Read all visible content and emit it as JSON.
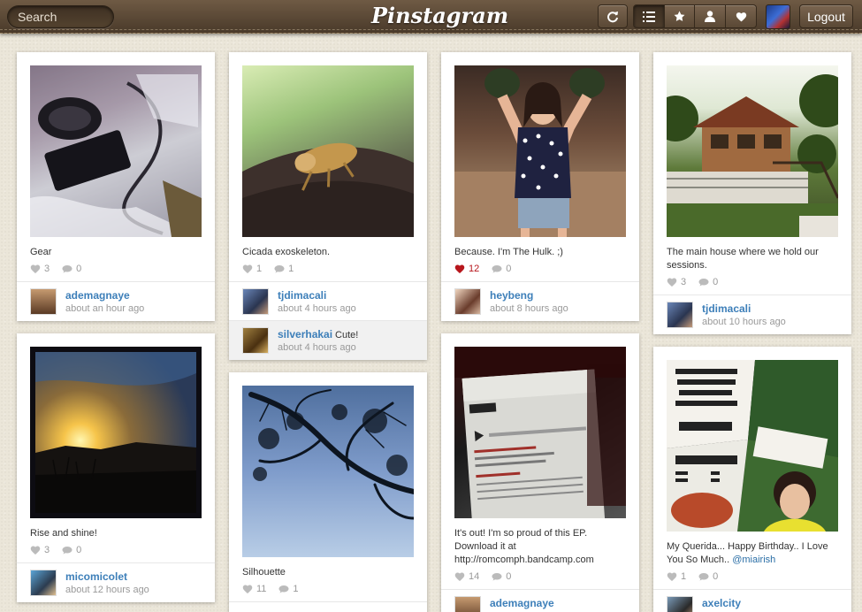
{
  "app": {
    "logo": "Pinstagram"
  },
  "search": {
    "placeholder": "Search"
  },
  "toolbar": {
    "logout_label": "Logout"
  },
  "icons": {
    "refresh": "refresh-icon",
    "list": "list-icon",
    "star": "star-icon",
    "user": "user-icon",
    "heart": "heart-icon",
    "comment": "comment-icon"
  },
  "colors": {
    "topbar": "#5a4835",
    "username": "#3d7fb9",
    "liked_heart": "#b7161c",
    "background": "#ebe6d9"
  },
  "posts": [
    {
      "caption": "Gear",
      "likes": "3",
      "comments": "0",
      "user": "ademagnaye",
      "time": "about an hour ago"
    },
    {
      "caption": "Rise and shine!",
      "likes": "3",
      "comments": "0",
      "user": "micomicolet",
      "time": "about 12 hours ago"
    },
    {
      "caption": "Cicada exoskeleton.",
      "likes": "1",
      "comments": "1",
      "user": "tjdimacali",
      "time": "about 4 hours ago",
      "comment": {
        "user": "silverhakai",
        "text": "Cute!",
        "time": "about 4 hours ago"
      }
    },
    {
      "caption": "Silhouette",
      "likes": "11",
      "comments": "1"
    },
    {
      "caption": "Because. I'm The Hulk. ;)",
      "likes": "12",
      "comments": "0",
      "user": "heybeng",
      "time": "about 8 hours ago"
    },
    {
      "caption": "It's out! I'm so proud of this EP. Download it at http://romcomph.bandcamp.com",
      "likes": "14",
      "comments": "0",
      "user": "ademagnaye"
    },
    {
      "caption": "The main house where we hold our sessions.",
      "likes": "3",
      "comments": "0",
      "user": "tjdimacali",
      "time": "about 10 hours ago"
    },
    {
      "caption": "My Querida... Happy Birthday.. I Love You So Much.. ",
      "mention": "@miairish",
      "likes": "1",
      "comments": "0",
      "user": "axelcity"
    }
  ]
}
